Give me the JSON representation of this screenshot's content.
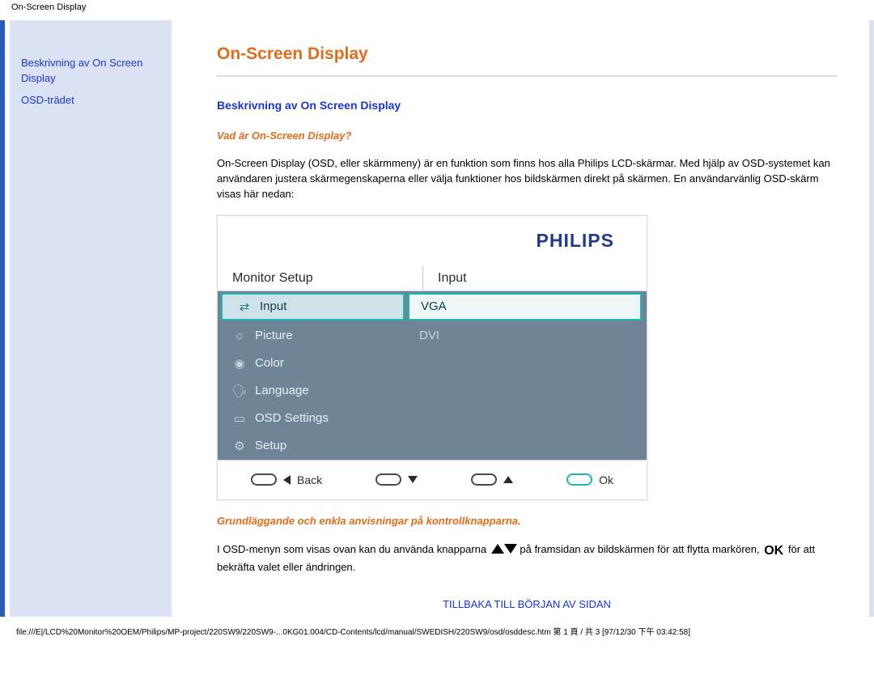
{
  "doc_header": "On-Screen Display",
  "sidebar": {
    "link1": "Beskrivning av On Screen Display",
    "link2": "OSD-trädet"
  },
  "page": {
    "title": "On-Screen Display",
    "section1_heading": "Beskrivning av On Screen Display",
    "q1": "Vad är On-Screen Display?",
    "para1": "On-Screen Display (OSD, eller skärmmeny) är en funktion som finns hos alla Philips LCD-skärmar. Med hjälp av OSD-systemet kan användaren justera skärmegenskaperna eller välja funktioner hos bildskärmen direkt på skärmen. En användarvänlig OSD-skärm visas här nedan:",
    "sub2": "Grundläggande och enkla anvisningar på kontrollknapparna.",
    "para2_a": "I OSD-menyn som visas ovan kan du använda knapparna ",
    "para2_b": " på framsidan av bildskärmen för att flytta markören, ",
    "para2_c": " för att bekräfta valet eller ändringen.",
    "ok_label": "OK",
    "back_to_top": "TILLBAKA TILL BÖRJAN AV SIDAN"
  },
  "osd": {
    "brand": "PHILIPS",
    "header_left": "Monitor Setup",
    "header_right": "Input",
    "menu": [
      {
        "label": "Input",
        "active": true
      },
      {
        "label": "Picture",
        "active": false
      },
      {
        "label": "Color",
        "active": false
      },
      {
        "label": "Language",
        "active": false
      },
      {
        "label": "OSD Settings",
        "active": false
      },
      {
        "label": "Setup",
        "active": false
      }
    ],
    "options": [
      {
        "label": "VGA",
        "active": true
      },
      {
        "label": "DVI",
        "active": false
      }
    ],
    "bottom": {
      "back": "Back",
      "ok": "Ok"
    }
  },
  "footer": "file:///E|/LCD%20Monitor%20OEM/Philips/MP-project/220SW9/220SW9-...0KG01.004/CD-Contents/lcd/manual/SWEDISH/220SW9/osd/osddesc.htm 第 1 頁 / 共 3  [97/12/30 下午 03:42:58]"
}
